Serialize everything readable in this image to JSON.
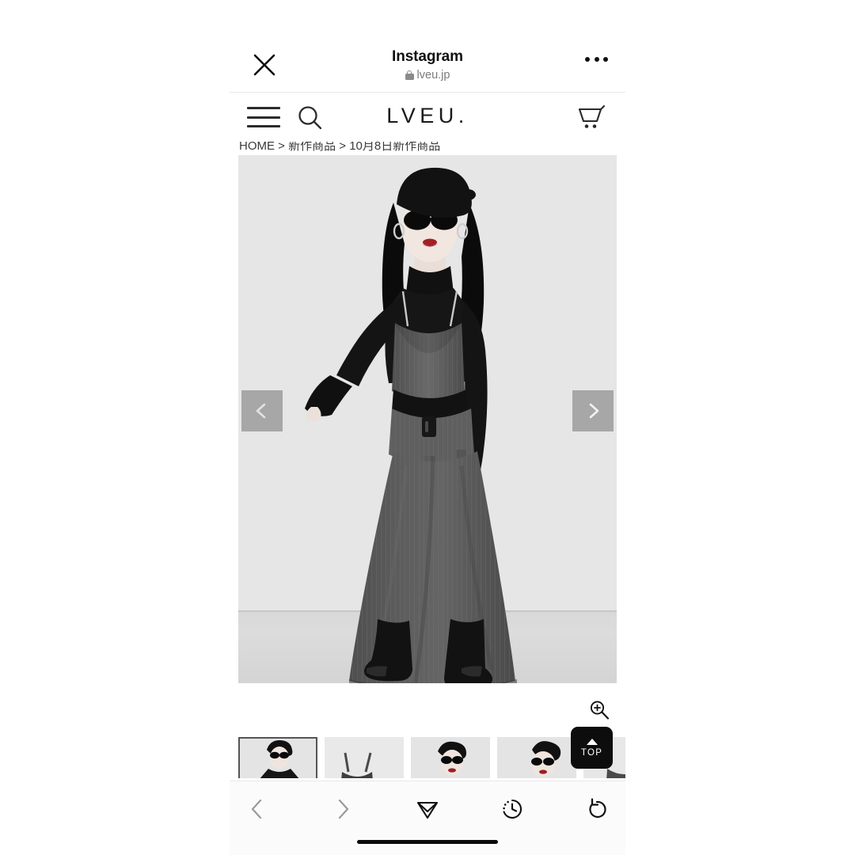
{
  "browser_header": {
    "title": "Instagram",
    "domain": "lveu.jp",
    "close_icon": "close-icon",
    "lock_icon": "lock-icon",
    "more_icon": "more-options-icon"
  },
  "site_nav": {
    "menu_icon": "hamburger-menu-icon",
    "search_icon": "search-icon",
    "brand": "LVEU.",
    "cart_icon": "shopping-cart-icon"
  },
  "breadcrumb": {
    "text": "HOME > 新作商品 > 10月8日新作商品",
    "items": [
      "HOME",
      "新作商品",
      "10月8日新作商品"
    ],
    "separator": ">"
  },
  "gallery": {
    "prev_icon": "chevron-left-icon",
    "next_icon": "chevron-right-icon",
    "zoom_icon": "zoom-in-icon",
    "image_alt": "Model wearing black beret, sunglasses, black turtleneck and grey pinstripe camisole long dress with belt",
    "background_color": "#e6e6e6",
    "thumbnails": [
      {
        "label": "thumbnail-1",
        "selected": true
      },
      {
        "label": "thumbnail-2",
        "selected": false
      },
      {
        "label": "thumbnail-3",
        "selected": false
      },
      {
        "label": "thumbnail-4",
        "selected": false
      },
      {
        "label": "thumbnail-5",
        "selected": false
      }
    ]
  },
  "top_button": {
    "label": "TOP",
    "arrow_icon": "triangle-up-icon",
    "background_color": "#0d0d0d"
  },
  "bottom_toolbar": {
    "back_icon": "chevron-left-icon",
    "forward_icon": "chevron-right-icon",
    "share_icon": "paper-plane-icon",
    "history_icon": "clock-history-icon",
    "reload_icon": "reload-icon"
  },
  "colors": {
    "page_background": "#ffffff",
    "toolbar_background": "#fbfbfb",
    "text_primary": "#111111",
    "text_secondary": "#7a7a7a",
    "disabled_icon": "#9a9a9a",
    "arrow_overlay": "rgba(128,128,128,0.62)"
  }
}
